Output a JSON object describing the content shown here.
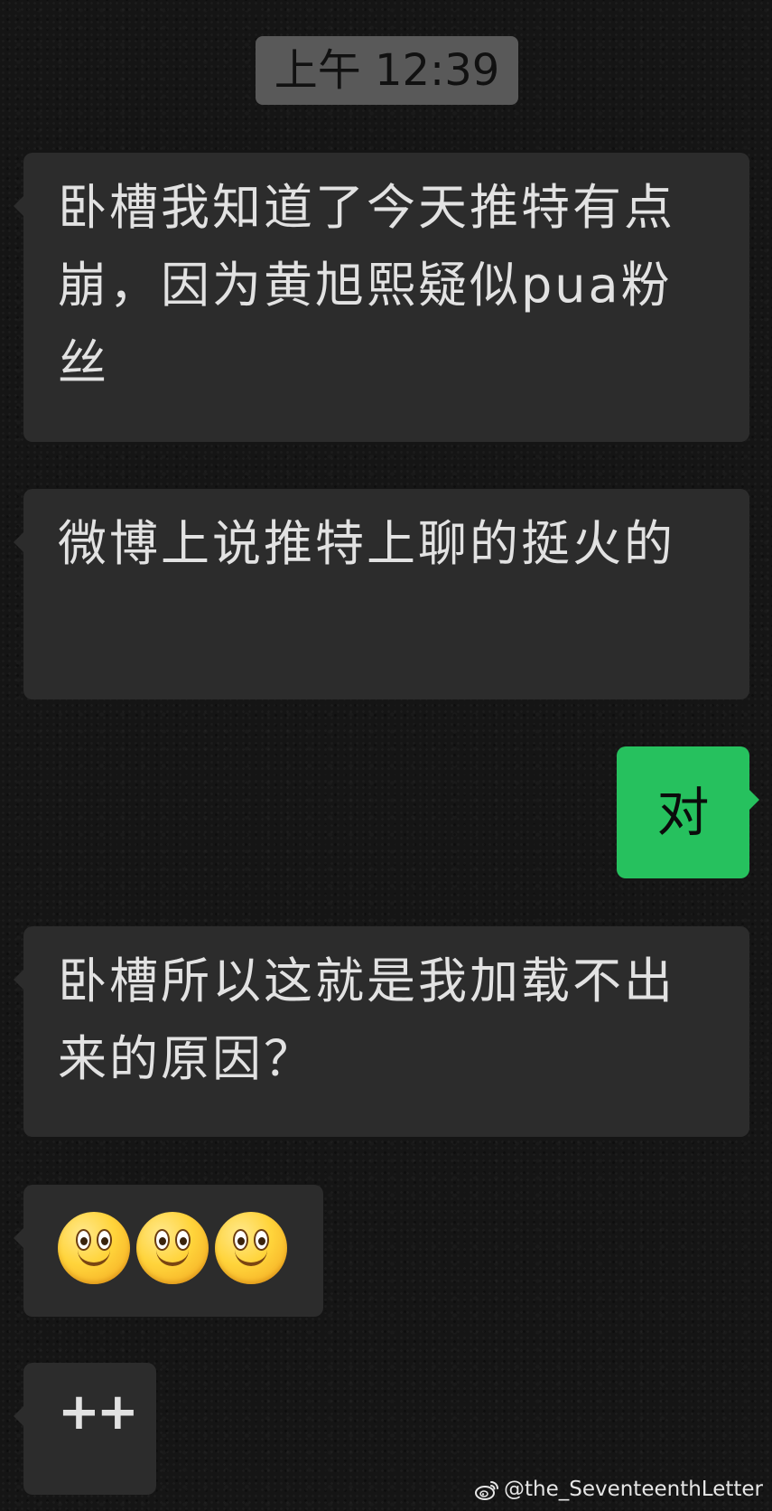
{
  "timestamp": "上午 12:39",
  "messages": [
    {
      "direction": "incoming",
      "text": "卧槽我知道了今天推特有点崩，因为黄旭熙疑似pua粉丝"
    },
    {
      "direction": "incoming",
      "text": "微博上说推特上聊的挺火的"
    },
    {
      "direction": "outgoing",
      "text": "对"
    },
    {
      "direction": "incoming",
      "text": "卧槽所以这就是我加载不出来的原因？"
    },
    {
      "direction": "incoming",
      "emoji": [
        "smile-emoji",
        "smile-emoji",
        "smile-emoji"
      ]
    },
    {
      "direction": "incoming",
      "text": "++"
    }
  ],
  "watermark": "@the_SeventeenthLetter",
  "colors": {
    "incoming_bubble": "#2c2c2c",
    "outgoing_bubble": "#26c15e",
    "timestamp_bg": "#595959"
  }
}
